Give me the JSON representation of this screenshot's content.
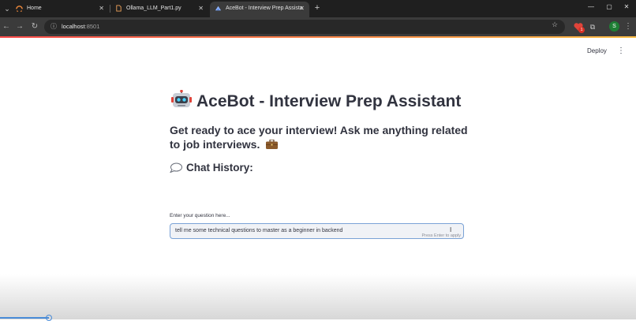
{
  "browser": {
    "tabs": [
      {
        "label": "Home",
        "active": false,
        "favicon": "home-favicon"
      },
      {
        "label": "Ollama_LLM_Part1.py",
        "active": false,
        "favicon": "file-favicon"
      },
      {
        "label": "AceBot - Interview Prep Assista",
        "active": true,
        "favicon": "streamlit-favicon"
      }
    ],
    "close_glyph": "✕",
    "new_tab_glyph": "+",
    "url_host": "localhost",
    "url_port": ":8501",
    "extension_badge": "1",
    "profile_initial": "S"
  },
  "app": {
    "deploy_label": "Deploy",
    "title": "AceBot - Interview Prep Assistant",
    "subtitle": "Get ready to ace your interview! Ask me anything related to job interviews.",
    "history_heading": "Chat History:",
    "input": {
      "label": "Enter your question here...",
      "value": "tell me some technical questions to master as a beginner in backend",
      "hint": "Press Enter to apply"
    }
  },
  "colors": {
    "accent_start": "#ff4b4b",
    "accent_end": "#ffbd45",
    "text": "#31333f",
    "input_border": "#7aa2d6",
    "input_bg": "#f0f2f6"
  },
  "icons": [
    "robot-emoji-icon",
    "briefcase-emoji-icon",
    "speech-bubble-icon",
    "star-icon",
    "extensions-icon",
    "kebab-menu-icon"
  ]
}
